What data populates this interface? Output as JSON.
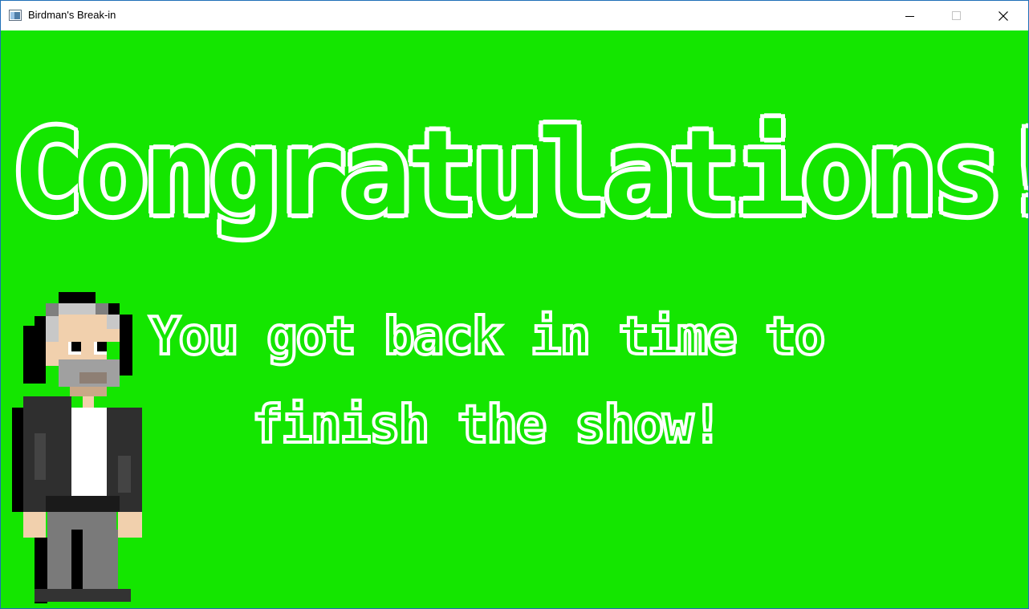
{
  "window": {
    "title": "Birdman's Break-in",
    "controls": [
      "minimize",
      "maximize",
      "close"
    ]
  },
  "game": {
    "background_color": "#14e600",
    "headline": "Congratulations!",
    "message_line_1": "You got back in time to",
    "message_line_2": "finish the show!",
    "character": "birdman-pixel-character"
  },
  "colors": {
    "text": "#ffffff",
    "titlebar": "#ffffff",
    "window_border": "#1f6fb8"
  }
}
